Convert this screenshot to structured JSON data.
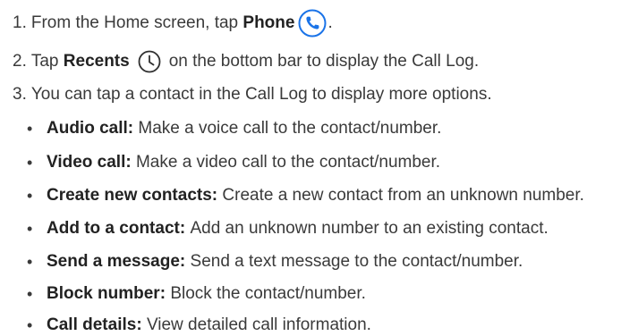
{
  "steps": [
    {
      "number": "1.",
      "pre": "From the Home screen, tap ",
      "bold": "Phone",
      "icon": "phone-icon",
      "post": "."
    },
    {
      "number": "2.",
      "pre": "Tap ",
      "bold": "Recents",
      "icon": "clock-icon",
      "post": "on the bottom bar to display the Call Log."
    },
    {
      "number": "3.",
      "text": "You can tap a contact in the Call Log to display more options."
    }
  ],
  "bullet_glyph": "•",
  "options": [
    {
      "term": "Audio call:",
      "desc": "Make a voice call to the contact/number."
    },
    {
      "term": "Video call:",
      "desc": "Make a video call to the contact/number."
    },
    {
      "term": "Create new contacts:",
      "desc": "Create a new contact from an unknown number."
    },
    {
      "term": "Add to a contact:",
      "desc": "Add an unknown number to an existing contact."
    },
    {
      "term": "Send a message:",
      "desc": "Send a text message to the contact/number."
    },
    {
      "term": "Block number:",
      "desc": "Block the contact/number."
    },
    {
      "term": "Call details:",
      "desc": "View detailed call information."
    }
  ],
  "colors": {
    "phone_icon_stroke": "#1a73e8",
    "clock_icon_stroke": "#2f2f2f",
    "text": "#3a3a3a"
  }
}
